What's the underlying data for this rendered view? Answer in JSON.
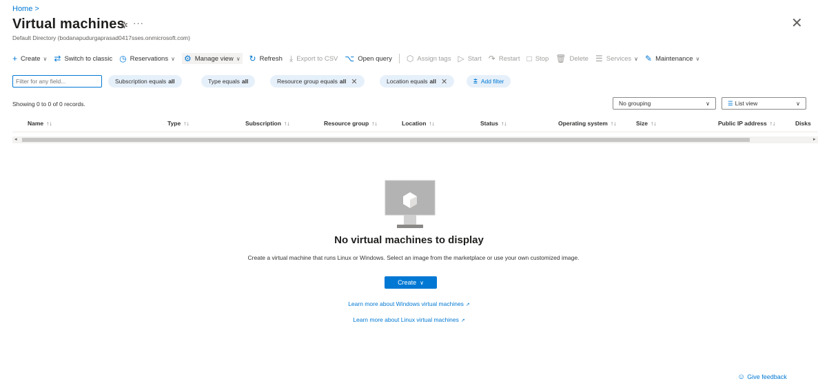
{
  "breadcrumb": "Home >",
  "header": {
    "title": "Virtual machines",
    "subtitle": "Default Directory (bodanapudurgaprasad0417sses.onmicrosoft.com)",
    "more": "···",
    "close": "✕"
  },
  "toolbar": {
    "create": "Create",
    "switch_classic": "Switch to classic",
    "reservations": "Reservations",
    "manage_view": "Manage view",
    "refresh": "Refresh",
    "export_csv": "Export to CSV",
    "open_query": "Open query",
    "assign_tags": "Assign tags",
    "start": "Start",
    "restart": "Restart",
    "stop": "Stop",
    "delete": "Delete",
    "services": "Services",
    "maintenance": "Maintenance"
  },
  "filters": {
    "search_placeholder": "Filter for any field...",
    "pills": [
      {
        "label": "Subscription equals",
        "value": "all"
      },
      {
        "label": "Type equals",
        "value": "all"
      },
      {
        "label": "Resource group equals",
        "value": "all"
      },
      {
        "label": "Location equals",
        "value": "all"
      }
    ],
    "add_filter": "Add filter"
  },
  "records_text": "Showing 0 to 0 of 0 records.",
  "grouping": {
    "value": "No grouping"
  },
  "view": {
    "value": "List view"
  },
  "columns": [
    "Name",
    "Type",
    "Subscription",
    "Resource group",
    "Location",
    "Status",
    "Operating system",
    "Size",
    "Public IP address",
    "Disks"
  ],
  "sort_glyph": "↑↓",
  "empty": {
    "title": "No virtual machines to display",
    "description": "Create a virtual machine that runs Linux or Windows. Select an image from the marketplace or use your own customized image.",
    "create_button": "Create",
    "link_windows": "Learn more about Windows virtual machines",
    "link_linux": "Learn more about Linux virtual machines"
  },
  "feedback": "Give feedback",
  "colors": {
    "accent": "#0078d4",
    "pill_bg": "#e6f0fa",
    "text": "#323130"
  }
}
